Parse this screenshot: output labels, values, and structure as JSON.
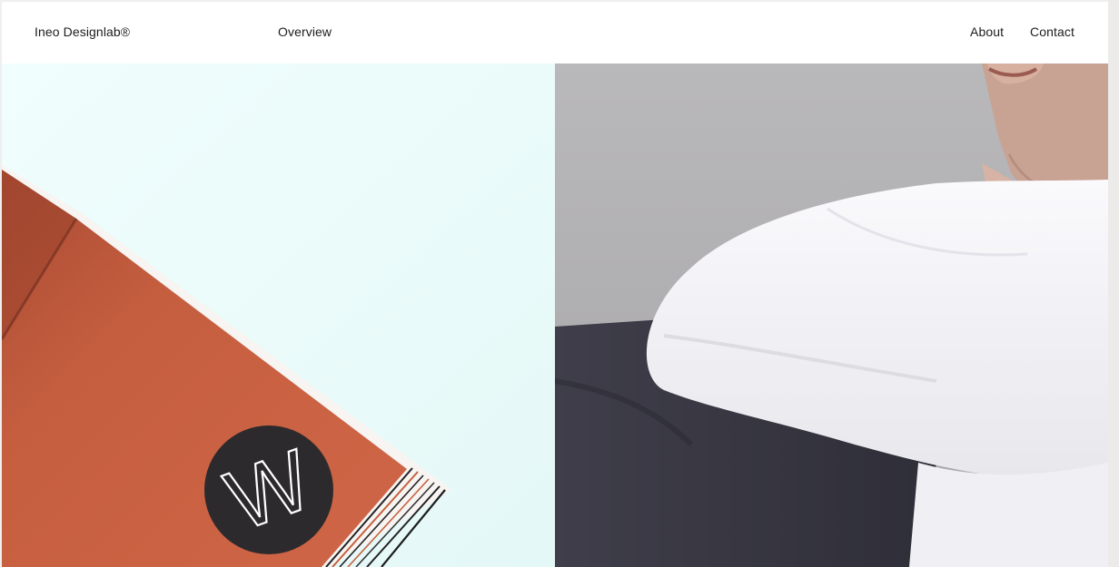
{
  "header": {
    "brand": "Ineo Designlab®",
    "nav_center": "Overview",
    "nav_right": [
      "About",
      "Contact"
    ]
  },
  "gallery": {
    "tiles": [
      {
        "name": "book-cover-photo",
        "logo_letter": "W",
        "colors": {
          "background": "#ebfdfc",
          "cover": "#c85f3f",
          "badge": "#2d2a2d"
        }
      },
      {
        "name": "white-shirt-photo",
        "colors": {
          "background": "#aeadaf",
          "shirt": "#f2f2f6",
          "jacket": "#3b3a45",
          "skin": "#c7a192"
        }
      }
    ]
  }
}
